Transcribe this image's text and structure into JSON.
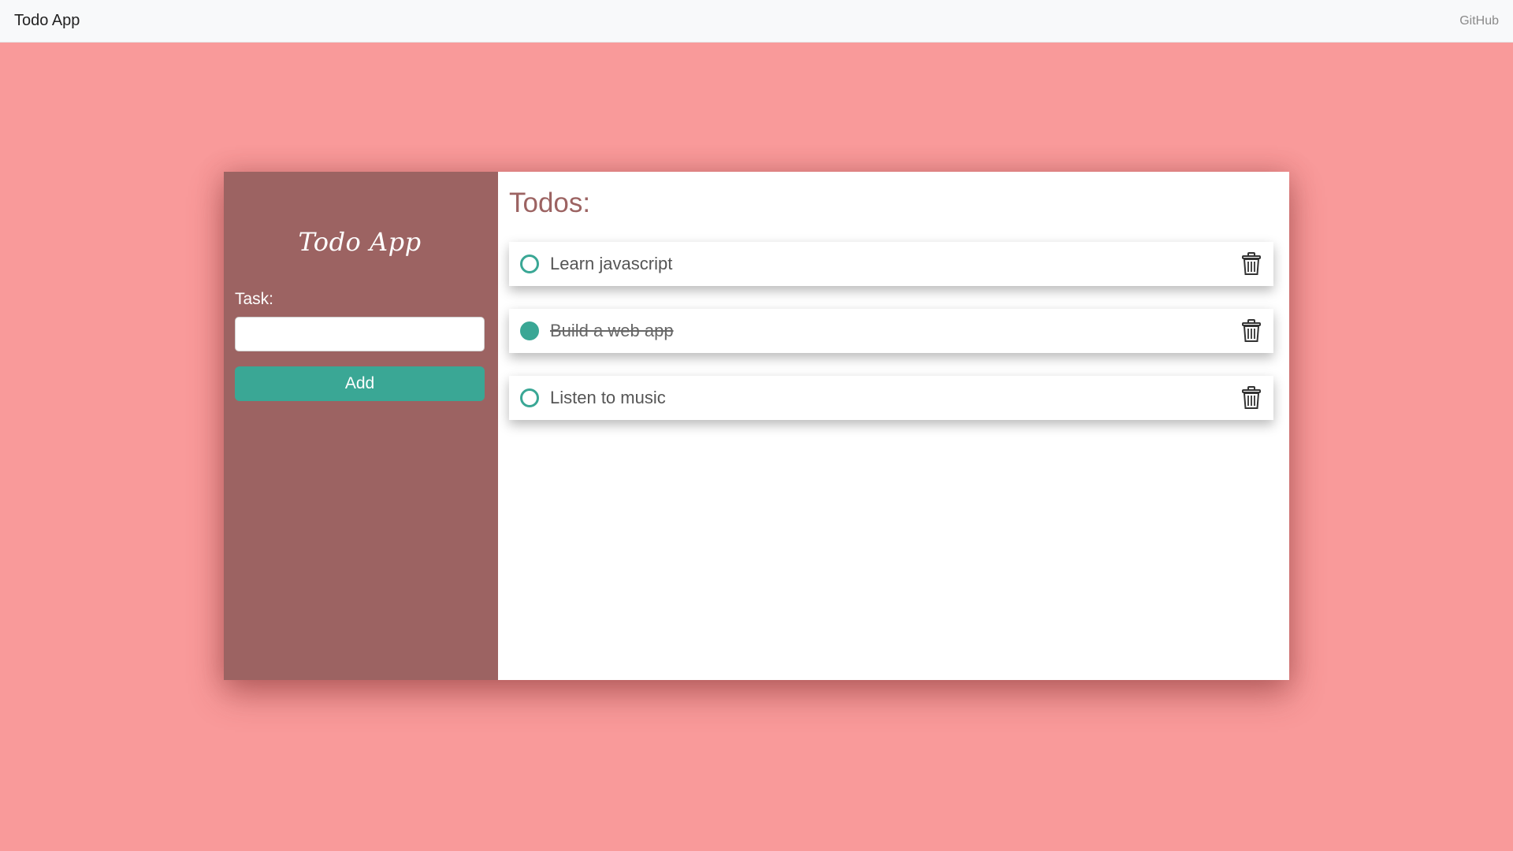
{
  "navbar": {
    "brand": "Todo App",
    "link": "GitHub"
  },
  "sidebar": {
    "title": "Todo App",
    "task_label": "Task:",
    "task_input_value": "",
    "add_label": "Add"
  },
  "main": {
    "title": "Todos:",
    "todos": [
      {
        "text": "Learn javascript",
        "done": false
      },
      {
        "text": "Build a web app",
        "done": true
      },
      {
        "text": "Listen to music",
        "done": false
      }
    ]
  },
  "colors": {
    "page_background": "#f99a9a",
    "sidebar_background": "#9c6362",
    "accent": "#3aa795",
    "title_color": "#9c6362"
  },
  "icons": {
    "check": "circle-check-icon",
    "delete": "trash-icon"
  }
}
